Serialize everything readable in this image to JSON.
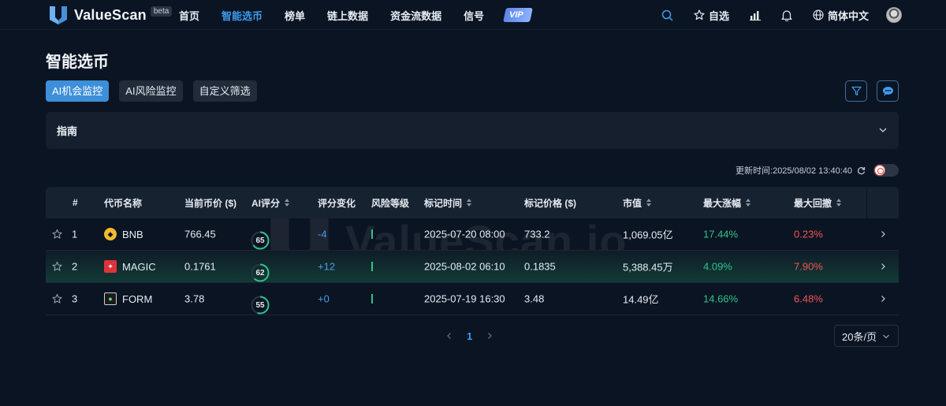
{
  "nav": {
    "brand": "ValueScan",
    "beta": "beta",
    "menu": [
      "首页",
      "智能选币",
      "榜单",
      "链上数据",
      "资金流数据",
      "信号"
    ],
    "active_menu": 1,
    "vip": "VIP",
    "watchlist": "自选",
    "language": "简体中文"
  },
  "page": {
    "title": "智能选币",
    "tabs": [
      "AI机会监控",
      "AI风险监控",
      "自定义筛选"
    ],
    "active_tab": 0,
    "guide": "指南",
    "update_time": "更新时间:2025/08/02 13:40:40"
  },
  "table": {
    "headers": [
      "#",
      "代币名称",
      "当前币价 ($)",
      "AI评分",
      "评分变化",
      "风险等级",
      "标记时间",
      "标记价格 ($)",
      "市值",
      "最大涨幅",
      "最大回撤"
    ],
    "rows": [
      {
        "rank": "1",
        "name": "BNB",
        "price": "766.45",
        "score": "65",
        "score_value": 65,
        "change": "-4",
        "time": "2025-07-20 08:00",
        "mark_price": "733.2",
        "mcap": "1,069.05亿",
        "max_gain": "17.44%",
        "max_dd": "0.23%"
      },
      {
        "rank": "2",
        "name": "MAGIC",
        "price": "0.1761",
        "score": "62",
        "score_value": 62,
        "change": "+12",
        "time": "2025-08-02 06:10",
        "mark_price": "0.1835",
        "mcap": "5,388.45万",
        "max_gain": "4.09%",
        "max_dd": "7.90%"
      },
      {
        "rank": "3",
        "name": "FORM",
        "price": "3.78",
        "score": "55",
        "score_value": 55,
        "change": "+0",
        "time": "2025-07-19 16:30",
        "mark_price": "3.48",
        "mcap": "14.49亿",
        "max_gain": "14.66%",
        "max_dd": "6.48%"
      }
    ]
  },
  "pagination": {
    "current": "1",
    "page_size": "20条/页"
  },
  "watermark": "ValueScan.io",
  "colors": {
    "accent": "#3d9cf0",
    "positive": "#2fc48a",
    "negative": "#f05656",
    "background": "#0b1422"
  }
}
